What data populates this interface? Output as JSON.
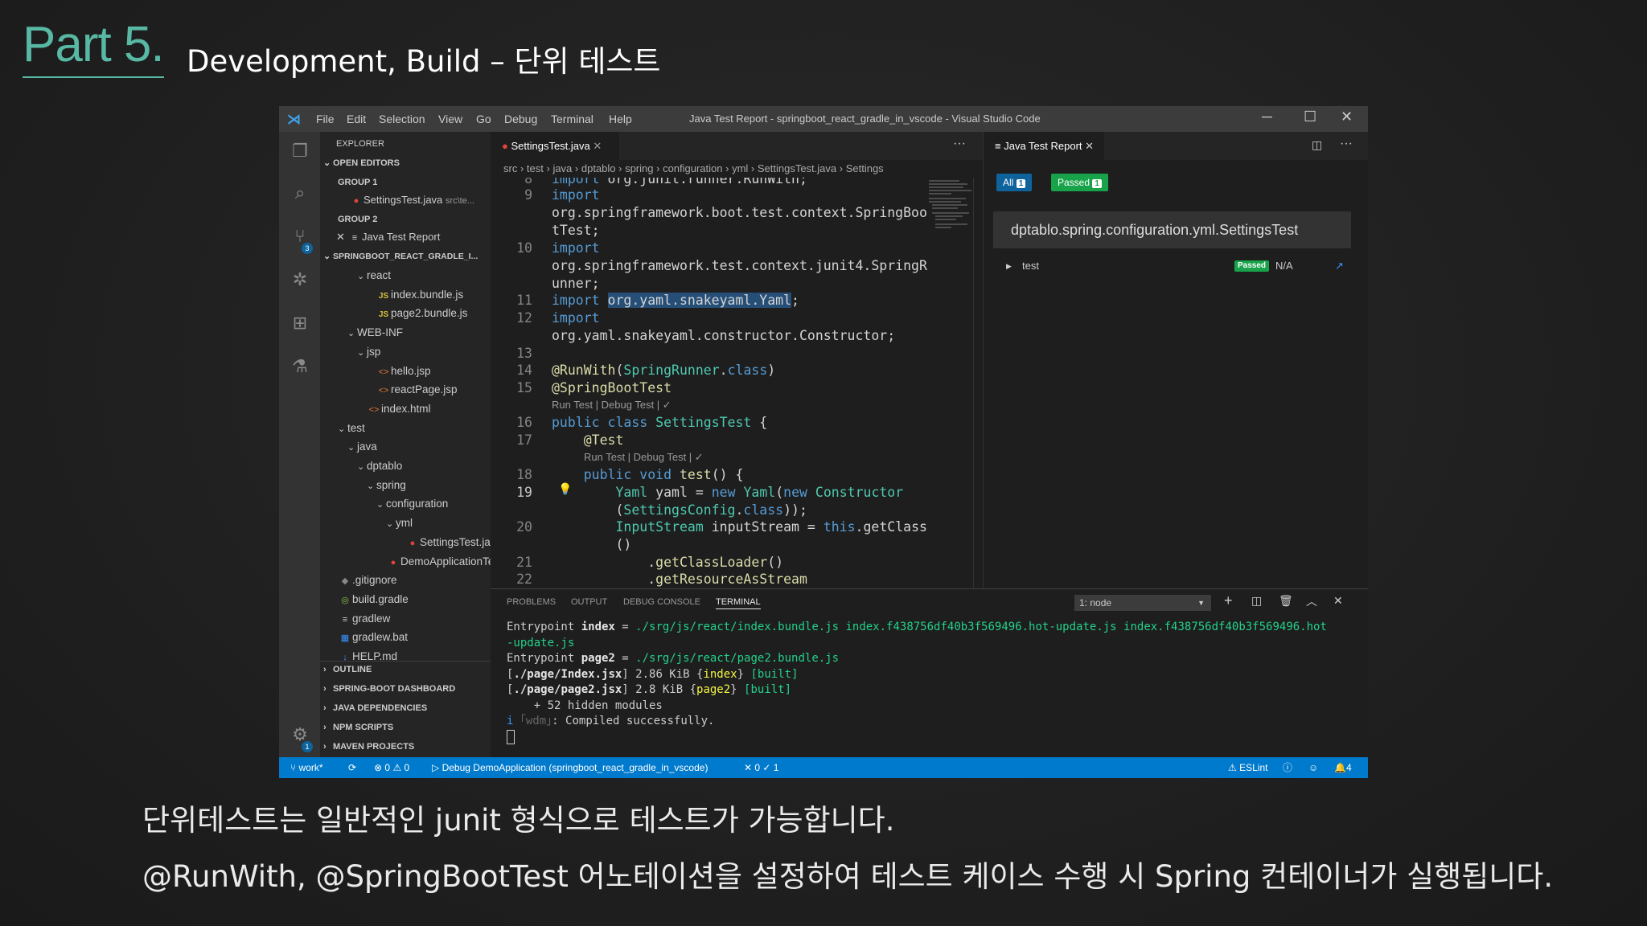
{
  "slide": {
    "part": "Part 5.",
    "title": "Development, Build – 단위 테스트",
    "caption_1": "단위테스트는 일반적인 junit 형식으로 테스트가 가능합니다.",
    "caption_2": "@RunWith, @SpringBootTest 어노테이션을 설정하여 테스트 케이스 수행 시 Spring 컨테이너가 실행됩니다."
  },
  "titlebar": {
    "menus": [
      "File",
      "Edit",
      "Selection",
      "View",
      "Go",
      "Debug",
      "Terminal",
      "Help"
    ],
    "window_title": "Java Test Report - springboot_react_gradle_in_vscode - Visual Studio Code"
  },
  "activity": {
    "scm_badge": "3",
    "settings_badge": "1"
  },
  "sidebar": {
    "header": "EXPLORER",
    "open_editors": "OPEN EDITORS",
    "group1": "GROUP 1",
    "group1_file": "SettingsTest.java",
    "group1_path": "src\\te...",
    "group2": "GROUP 2",
    "group2_file": "Java Test Report",
    "project": "SPRINGBOOT_REACT_GRADLE_I...",
    "tree": [
      {
        "label": "react",
        "indent": 3,
        "chev": "⌄",
        "icon": ""
      },
      {
        "label": "index.bundle.js",
        "indent": 4,
        "chev": "",
        "icon": "JS"
      },
      {
        "label": "page2.bundle.js",
        "indent": 4,
        "chev": "",
        "icon": "JS"
      },
      {
        "label": "WEB-INF",
        "indent": 2,
        "chev": "⌄",
        "icon": ""
      },
      {
        "label": "jsp",
        "indent": 3,
        "chev": "⌄",
        "icon": ""
      },
      {
        "label": "hello.jsp",
        "indent": 4,
        "chev": "",
        "icon": "<>"
      },
      {
        "label": "reactPage.jsp",
        "indent": 4,
        "chev": "",
        "icon": "<>"
      },
      {
        "label": "index.html",
        "indent": 3,
        "chev": "",
        "icon": "<>"
      },
      {
        "label": "test",
        "indent": 1,
        "chev": "⌄",
        "icon": ""
      },
      {
        "label": "java",
        "indent": 2,
        "chev": "⌄",
        "icon": ""
      },
      {
        "label": "dptablo",
        "indent": 3,
        "chev": "⌄",
        "icon": ""
      },
      {
        "label": "spring",
        "indent": 4,
        "chev": "⌄",
        "icon": ""
      },
      {
        "label": "configuration",
        "indent": 5,
        "chev": "⌄",
        "icon": ""
      },
      {
        "label": "yml",
        "indent": 6,
        "chev": "⌄",
        "icon": ""
      },
      {
        "label": "SettingsTest.java",
        "indent": 7,
        "chev": "",
        "icon": "●"
      },
      {
        "label": "DemoApplicationTe...",
        "indent": 5,
        "chev": "",
        "icon": "●"
      },
      {
        "label": ".gitignore",
        "indent": 0,
        "chev": "",
        "icon": "◆"
      },
      {
        "label": "build.gradle",
        "indent": 0,
        "chev": "",
        "icon": "◎"
      },
      {
        "label": "gradlew",
        "indent": 0,
        "chev": "",
        "icon": "≡"
      },
      {
        "label": "gradlew.bat",
        "indent": 0,
        "chev": "",
        "icon": "▦"
      },
      {
        "label": "HELP.md",
        "indent": 0,
        "chev": "",
        "icon": "↓"
      }
    ],
    "sections": [
      "OUTLINE",
      "SPRING-BOOT DASHBOARD",
      "JAVA DEPENDENCIES",
      "NPM SCRIPTS",
      "MAVEN PROJECTS"
    ]
  },
  "editor": {
    "tab": "SettingsTest.java",
    "breadcrumb": [
      "src",
      "test",
      "java",
      "dptablo",
      "spring",
      "configuration",
      "yml",
      "SettingsTest.java",
      "Settings"
    ],
    "lens": "Run Test | Debug Test | ✓"
  },
  "report": {
    "tab": "Java Test Report",
    "all_label": "All",
    "all_count": "1",
    "passed_label": "Passed",
    "passed_count": "1",
    "class_name": "dptablo.spring.configuration.yml.SettingsTest",
    "test_name": "test",
    "test_status": "Passed",
    "test_time": "N/A"
  },
  "panel": {
    "tabs": [
      "PROBLEMS",
      "OUTPUT",
      "DEBUG CONSOLE",
      "TERMINAL"
    ],
    "terminal_select": "1: node"
  },
  "statusbar": {
    "branch": "work*",
    "errors": "0",
    "warnings": "0",
    "debug": "Debug DemoApplication (springboot_react_gradle_in_vscode)",
    "tests": "✕ 0 ✓ 1",
    "eslint": "ESLint",
    "notifications": "4"
  },
  "colors": {
    "accent": "#007acc",
    "part_teal": "#58b8a4",
    "passed": "#18a34a"
  }
}
